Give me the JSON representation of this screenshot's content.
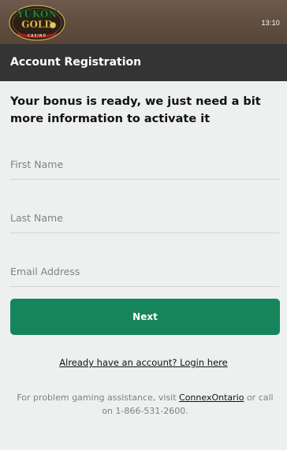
{
  "status_bar": {
    "time": "13:10"
  },
  "brand": {
    "line1": "YUKON",
    "line2": "GOLD",
    "line3": "CASINO",
    "colors": {
      "gold": "#e2c75a",
      "green": "#1c6b2e",
      "red": "#a8201f"
    }
  },
  "header": {
    "title": "Account Registration"
  },
  "form": {
    "headline": "Your bonus is ready, we just need a bit more information to activate it",
    "first_name": {
      "placeholder": "First Name",
      "value": ""
    },
    "last_name": {
      "placeholder": "Last Name",
      "value": ""
    },
    "email": {
      "placeholder": "Email Address",
      "value": ""
    },
    "next_label": "Next"
  },
  "login_link": "Already have an account? Login here",
  "footer": {
    "prefix": "For problem gaming assistance, visit ",
    "link": "ConnexOntario",
    "suffix": " or call on 1-866-531-2600."
  },
  "colors": {
    "topbar": "#5f4d40",
    "header": "#343434",
    "button": "#16855c",
    "background": "#eef0f0"
  }
}
